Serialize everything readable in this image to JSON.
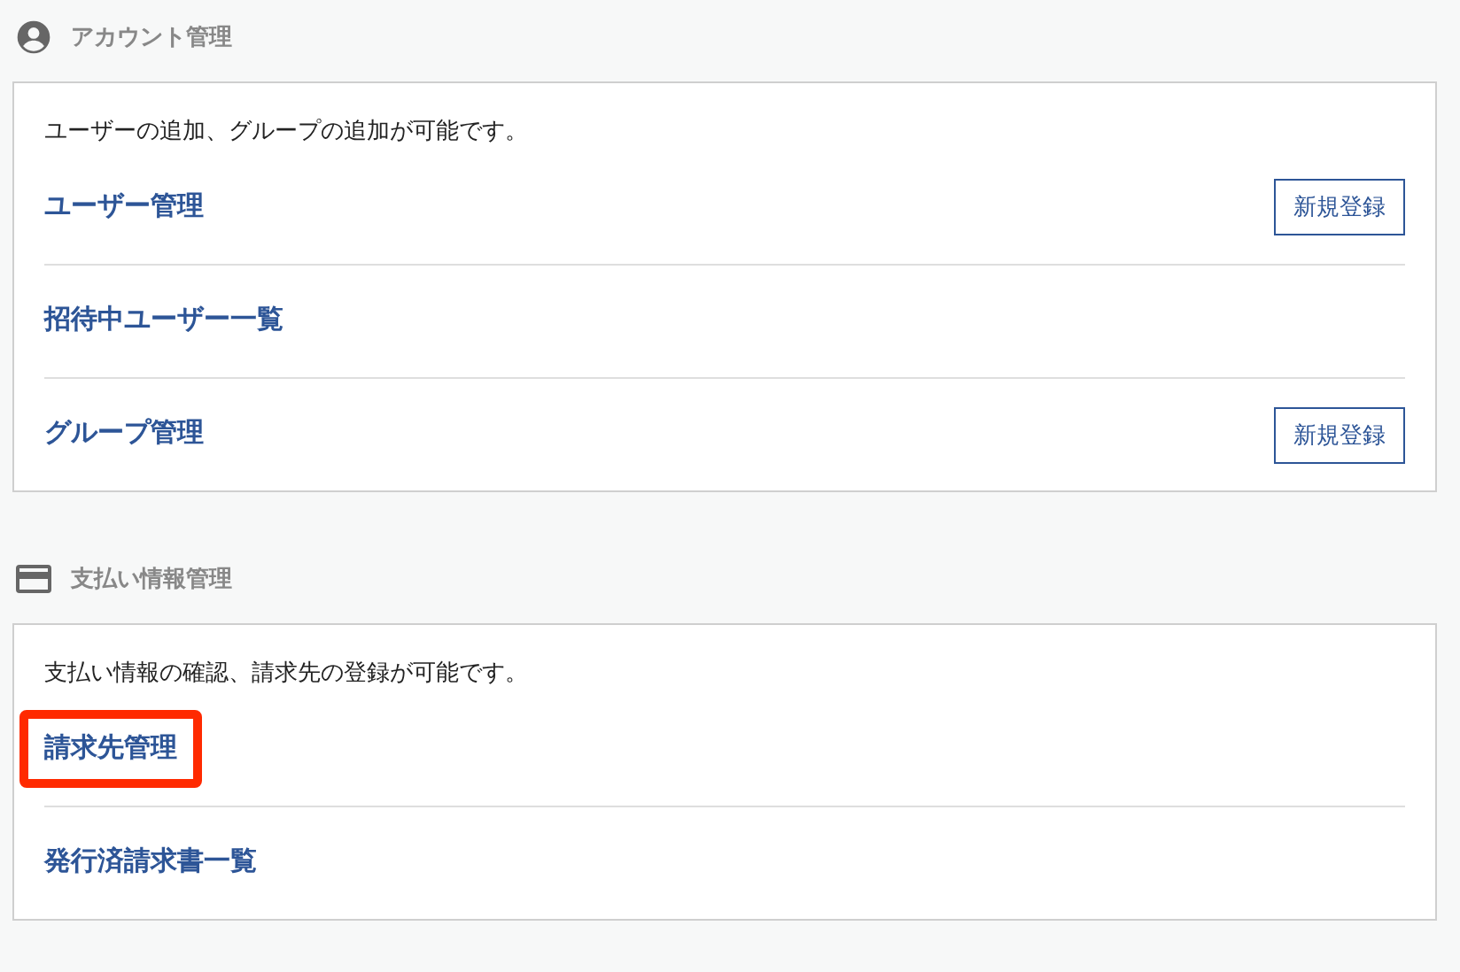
{
  "sections": [
    {
      "kind": "account",
      "title": "アカウント管理",
      "description": "ユーザーの追加、グループの追加が可能です。",
      "items": [
        {
          "label": "ユーザー管理",
          "button": "新規登録",
          "highlighted": false
        },
        {
          "label": "招待中ユーザー一覧",
          "highlighted": false
        },
        {
          "label": "グループ管理",
          "button": "新規登録",
          "highlighted": false
        }
      ]
    },
    {
      "kind": "payment",
      "title": "支払い情報管理",
      "description": "支払い情報の確認、請求先の登録が可能です。",
      "items": [
        {
          "label": "請求先管理",
          "highlighted": true
        },
        {
          "label": "発行済請求書一覧",
          "highlighted": false
        }
      ]
    }
  ]
}
